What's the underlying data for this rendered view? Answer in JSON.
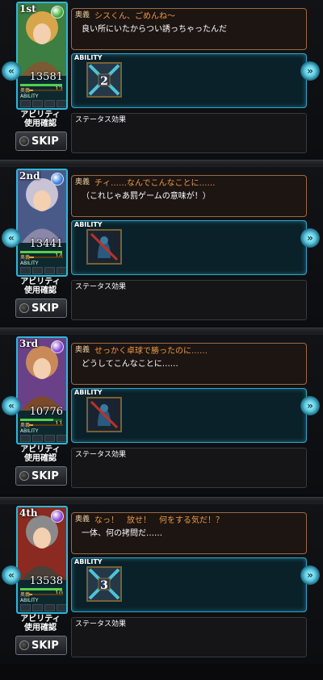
{
  "ui": {
    "ability_label": "ABILITY",
    "status_label": "ステータス効果",
    "ability_check_label_line1": "アビリティ",
    "ability_check_label_line2": "使用確認",
    "skip_label": "SKIP",
    "ougi_small": "奥義",
    "ability_small": "ABILITY",
    "arrow_left": "«",
    "arrow_right": "»"
  },
  "characters": [
    {
      "rank": "1st",
      "hp": "13581",
      "ougi_value": "12",
      "hp_fill": 1.0,
      "ougi_fill": 0.12,
      "element_color": "#3fae3a",
      "portrait_colors": [
        "#d9a54a",
        "#7c5a33",
        "#3d7e42"
      ],
      "speaker": "奥義",
      "line1": "シスくん、ごめんね～",
      "line2": "良い所にいたからつい誘っちゃったんだ",
      "ability_count": "2",
      "ability_icon": "crossed-swords-icon"
    },
    {
      "rank": "2nd",
      "hp": "13441",
      "ougi_value": "14",
      "hp_fill": 1.0,
      "ougi_fill": 0.14,
      "element_color": "#3a7ee0",
      "portrait_colors": [
        "#c9c3d6",
        "#8a87a8",
        "#4a5a88"
      ],
      "speaker": "奥義",
      "line1": "チィ……なんでこんなことに……",
      "line2": "（これじゃあ罰ゲームの意味が！）",
      "ability_count": "",
      "ability_icon": "sealed-figure-icon"
    },
    {
      "rank": "3rd",
      "hp": "10776",
      "ougi_value": "11",
      "hp_fill": 0.79,
      "ougi_fill": 0.11,
      "element_color": "#8a4ad8",
      "portrait_colors": [
        "#c98a5a",
        "#7a4a2a",
        "#6a4088"
      ],
      "speaker": "奥義",
      "line1": "せっかく卓球で勝ったのに……",
      "line2": "どうしてこんなことに……",
      "ability_count": "",
      "ability_icon": "sealed-figure-icon"
    },
    {
      "rank": "4th",
      "hp": "13538",
      "ougi_value": "10",
      "hp_fill": 1.0,
      "ougi_fill": 0.1,
      "element_color": "#8a4ad8",
      "portrait_colors": [
        "#8a8a8a",
        "#4a4038",
        "#8a2a20"
      ],
      "speaker": "奥義",
      "line1": "なっ！　放せ！　何をする気だ！？",
      "line2": "一体、何の拷問だ……",
      "ability_count": "3",
      "ability_icon": "crossed-swords-icon"
    }
  ]
}
